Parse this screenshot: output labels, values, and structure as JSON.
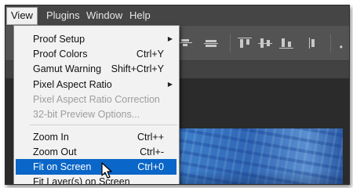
{
  "menubar": {
    "items": [
      {
        "label": "View",
        "active": true
      },
      {
        "label": "Plugins",
        "active": false
      },
      {
        "label": "Window",
        "active": false
      },
      {
        "label": "Help",
        "active": false
      }
    ]
  },
  "toolbar": {
    "icons": [
      "align-center-icon",
      "align-middle-icon",
      "align-top-edges-icon",
      "align-vertical-centers-icon",
      "align-bottom-edges-icon",
      "align-left-edges-icon"
    ],
    "more_label": "•"
  },
  "view_menu": {
    "items": [
      {
        "label": "Proof Setup",
        "shortcut": "",
        "submenu": true,
        "disabled": false
      },
      {
        "label": "Proof Colors",
        "shortcut": "Ctrl+Y",
        "submenu": false,
        "disabled": false
      },
      {
        "label": "Gamut Warning",
        "shortcut": "Shift+Ctrl+Y",
        "submenu": false,
        "disabled": false
      },
      {
        "label": "Pixel Aspect Ratio",
        "shortcut": "",
        "submenu": true,
        "disabled": false
      },
      {
        "label": "Pixel Aspect Ratio Correction",
        "shortcut": "",
        "submenu": false,
        "disabled": true
      },
      {
        "label": "32-bit Preview Options...",
        "shortcut": "",
        "submenu": false,
        "disabled": true
      },
      {
        "label": "Zoom In",
        "shortcut": "Ctrl++",
        "submenu": false,
        "disabled": false
      },
      {
        "label": "Zoom Out",
        "shortcut": "Ctrl+-",
        "submenu": false,
        "disabled": false
      },
      {
        "label": "Fit on Screen",
        "shortcut": "Ctrl+0",
        "submenu": false,
        "disabled": false,
        "selected": true
      },
      {
        "label": "Fit Layer(s) on Screen",
        "shortcut": "",
        "submenu": false,
        "disabled": false
      }
    ],
    "submenu_arrow": "▶"
  },
  "colors": {
    "selection": "#0a66c8",
    "menu_bg": "#f2f2f2",
    "app_bg": "#535353",
    "disabled_text": "#9d9d9d"
  }
}
